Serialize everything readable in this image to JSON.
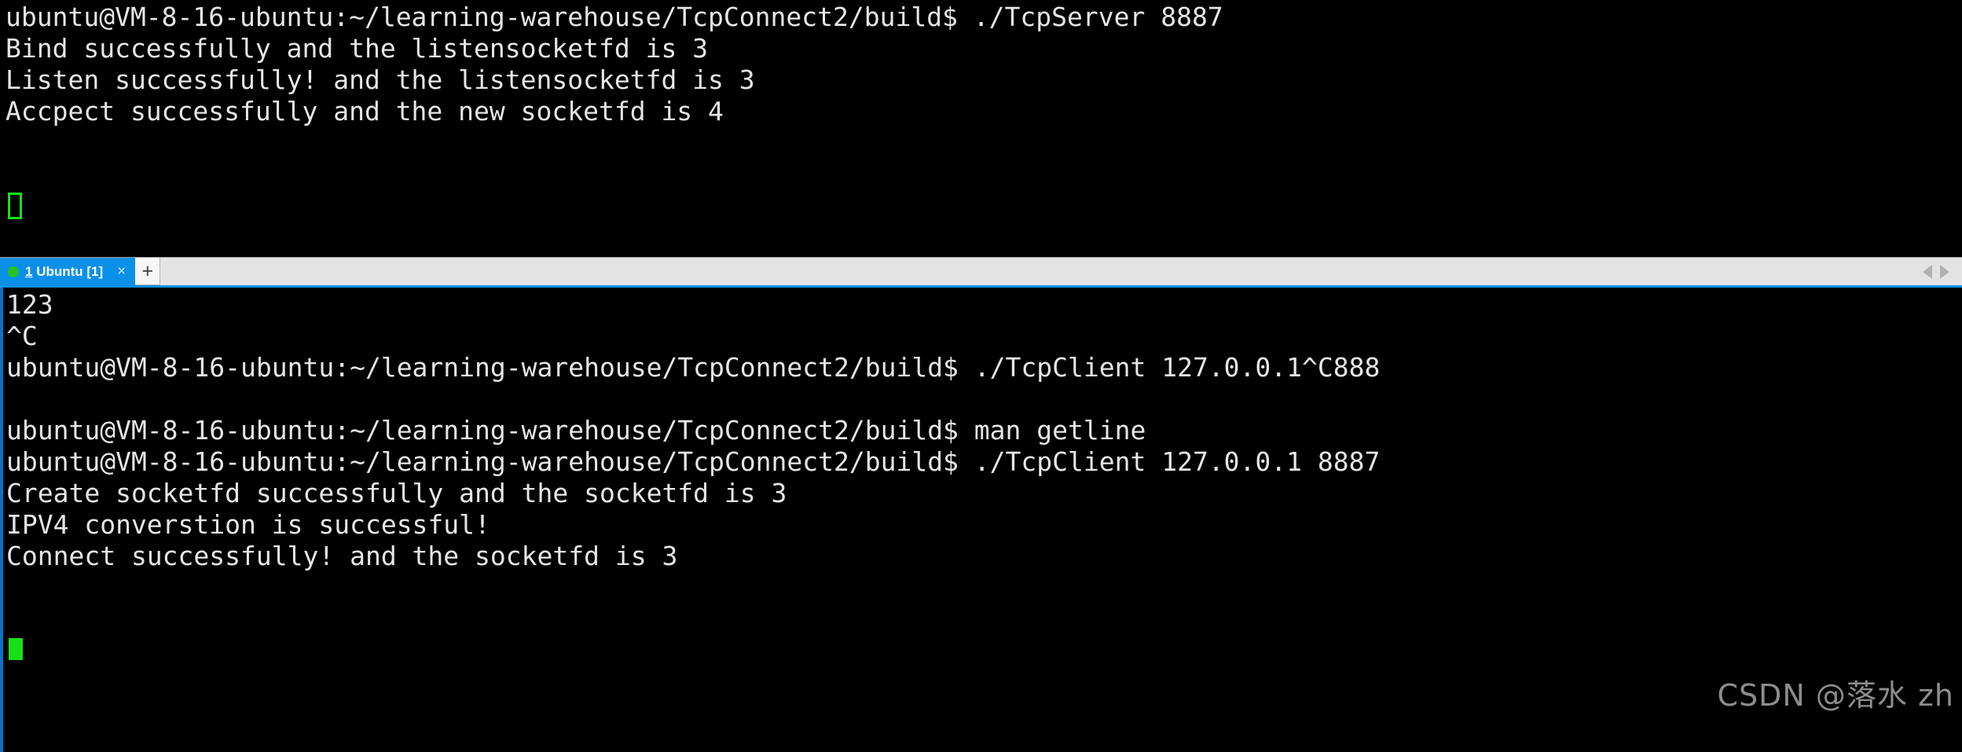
{
  "app": {
    "title": "Ubuntu Terminal",
    "background_color": "#000000",
    "foreground_color": "#e6e6e6",
    "accent_color": "#0a90e8",
    "cursor_color": "#18e018"
  },
  "top_pane": {
    "name": "terminal-pane-server",
    "lines": [
      "ubuntu@VM-8-16-ubuntu:~/learning-warehouse/TcpConnect2/build$ ./TcpServer 8887",
      "Bind successfully and the listensocketfd is 3",
      "Listen successfully! and the listensocketfd is 3",
      "Accpect successfully and the new socketfd is 4"
    ],
    "cursor": {
      "style": "hollow-block",
      "color": "#18e018",
      "focused": false
    }
  },
  "tabbar": {
    "name": "terminal-tab-bar",
    "tabs": [
      {
        "status_dot": "green",
        "index_label": "1",
        "label_rest": " Ubuntu [1]",
        "full_label": "1 Ubuntu [1]",
        "active": true,
        "close_glyph": "×"
      }
    ],
    "new_tab_glyph": "+",
    "scroll_left_icon": "chevron-left-icon",
    "scroll_right_icon": "chevron-right-icon"
  },
  "bottom_pane": {
    "name": "terminal-pane-client",
    "active": true,
    "lines": [
      "123",
      "^C",
      "ubuntu@VM-8-16-ubuntu:~/learning-warehouse/TcpConnect2/build$ ./TcpClient 127.0.0.1^C888",
      "",
      "ubuntu@VM-8-16-ubuntu:~/learning-warehouse/TcpConnect2/build$ man getline",
      "ubuntu@VM-8-16-ubuntu:~/learning-warehouse/TcpConnect2/build$ ./TcpClient 127.0.0.1 8887",
      "Create socketfd successfully and the socketfd is 3",
      "IPV4 converstion is successful!",
      "Connect successfully! and the socketfd is 3"
    ],
    "cursor": {
      "style": "solid-block",
      "color": "#18e018",
      "focused": true
    }
  },
  "watermark": {
    "text": "CSDN @落水 zh",
    "color": "#8d8d8d"
  }
}
